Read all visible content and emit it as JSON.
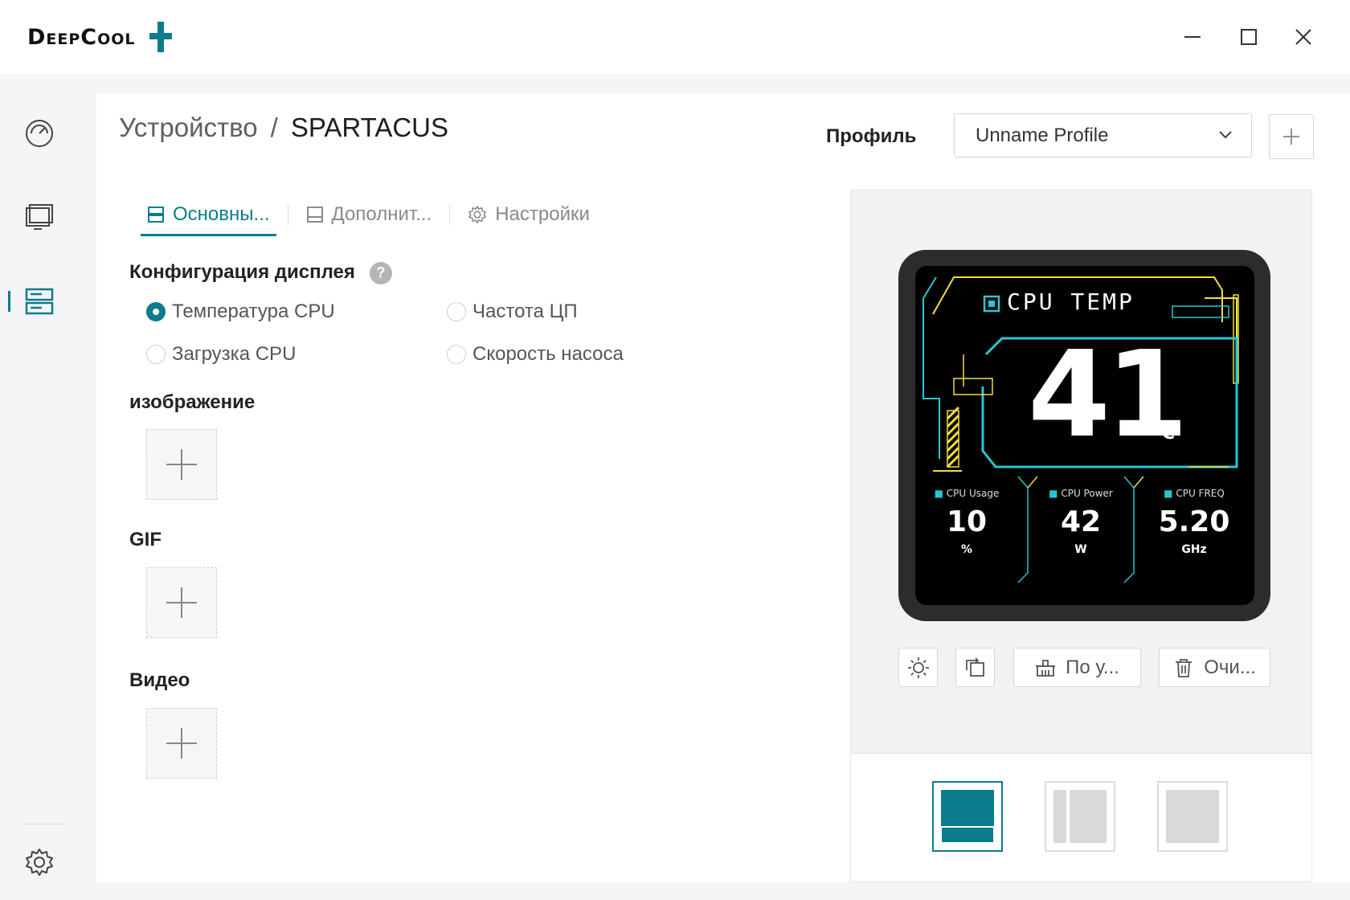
{
  "app": {
    "logo_text": "DeepCool"
  },
  "breadcrumb": {
    "parent": "Устройство",
    "separator": "/",
    "current": "SPARTACUS"
  },
  "profile": {
    "label": "Профиль",
    "selected": "Unname Profile"
  },
  "tabs": [
    {
      "label": "Основны...",
      "icon": "display-settings-icon",
      "active": true
    },
    {
      "label": "Дополнит...",
      "icon": "layout-icon",
      "active": false
    },
    {
      "label": "Настройки",
      "icon": "gear-icon",
      "active": false
    }
  ],
  "display_config": {
    "title": "Конфигурация дисплея",
    "help": "?",
    "options": [
      {
        "label": "Температура CPU",
        "checked": true
      },
      {
        "label": "Частота ЦП",
        "checked": false
      },
      {
        "label": "Загрузка CPU",
        "checked": false
      },
      {
        "label": "Скорость насоса",
        "checked": false
      }
    ]
  },
  "media": {
    "image_title": "изображение",
    "gif_title": "GIF",
    "video_title": "Видео"
  },
  "preview": {
    "main_label": "CPU TEMP",
    "main_value": "41",
    "main_unit": "°C",
    "stats": [
      {
        "label": "CPU Usage",
        "value": "10",
        "unit": "%"
      },
      {
        "label": "CPU Power",
        "value": "42",
        "unit": "W"
      },
      {
        "label": "CPU FREQ",
        "value": "5.20",
        "unit": "GHz"
      }
    ],
    "accent_cyan": "#27c6d6",
    "accent_yellow": "#f4e034"
  },
  "controls": {
    "reset_label": "По у...",
    "clear_label": "Очи..."
  },
  "theme": {
    "accent": "#0b7c8d"
  }
}
